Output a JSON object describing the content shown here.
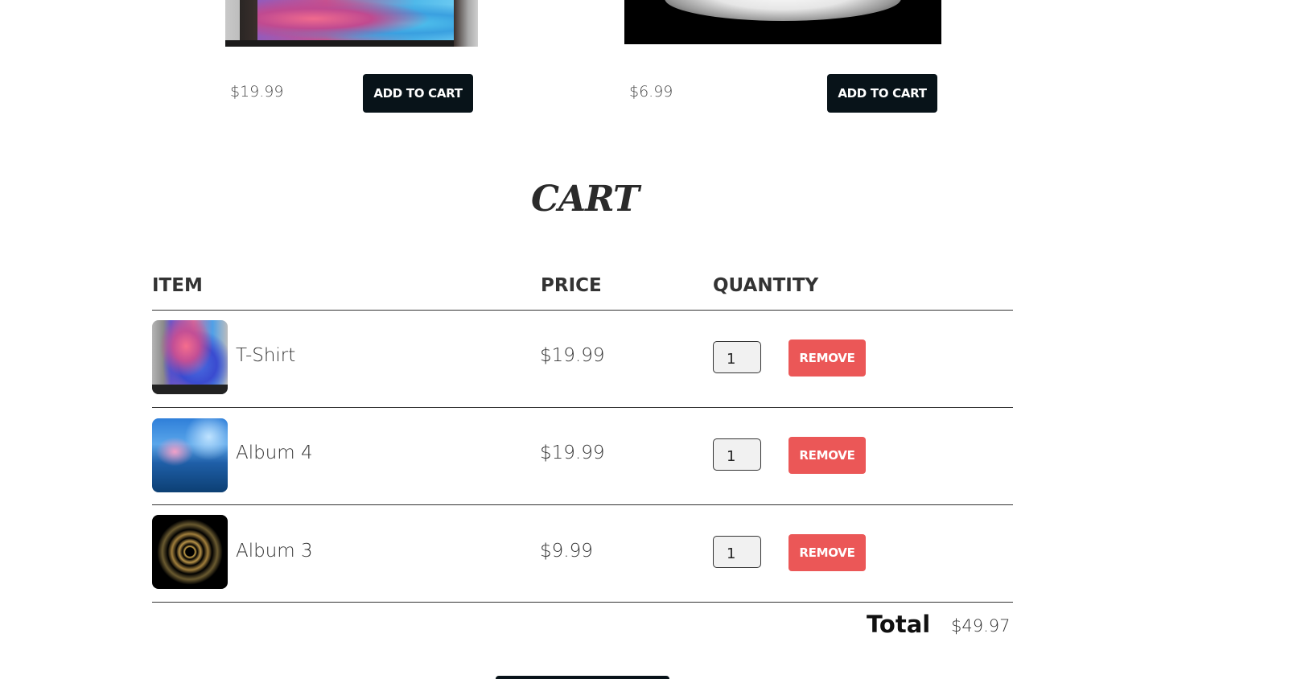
{
  "products": [
    {
      "price": "$19.99",
      "add_label": "ADD TO CART",
      "image": "t-shirt-photo"
    },
    {
      "price": "$6.99",
      "add_label": "ADD TO CART",
      "image": "coffee-cup-photo"
    }
  ],
  "cart": {
    "title": "CART",
    "headers": {
      "item": "ITEM",
      "price": "PRICE",
      "quantity": "QUANTITY"
    },
    "rows": [
      {
        "name": "T-Shirt",
        "price": "$19.99",
        "quantity": "1",
        "remove_label": "REMOVE"
      },
      {
        "name": "Album 4",
        "price": "$19.99",
        "quantity": "1",
        "remove_label": "REMOVE"
      },
      {
        "name": "Album 3",
        "price": "$9.99",
        "quantity": "1",
        "remove_label": "REMOVE"
      }
    ],
    "total_label": "Total",
    "total_value": "$49.97"
  },
  "colors": {
    "dark_button": "#081319",
    "remove_button": "#eb5757",
    "text": "#333333"
  }
}
